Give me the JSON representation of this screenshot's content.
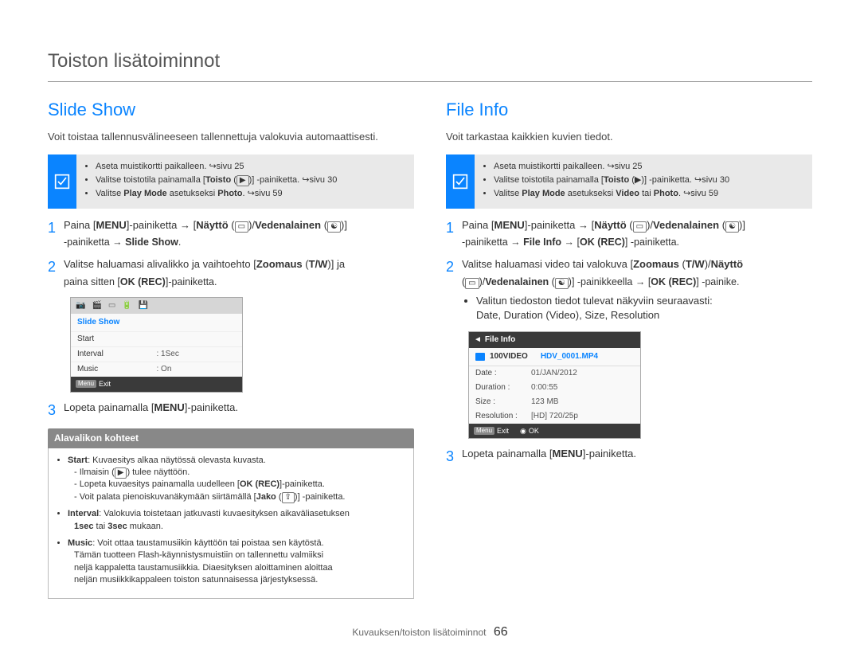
{
  "page_title": "Toiston lisätoiminnot",
  "footer": {
    "section": "Kuvauksen/toiston lisätoiminnot",
    "page_number": "66"
  },
  "left": {
    "title": "Slide Show",
    "intro": "Voit toistaa tallennusvälineeseen tallennettuja valokuvia automaattisesti.",
    "note": {
      "items": [
        {
          "pre": "Aseta muistikortti paikalleen. ",
          "arrow": "↪",
          "suf": "sivu 25"
        },
        {
          "pre": "Valitse toistotila painamalla [",
          "bold": "Toisto",
          " (": " (",
          "icon": "▶",
          ")": ")",
          "post": "] -painiketta. ",
          "arrow2": "↪",
          "suf2": "sivu 30"
        },
        {
          "pre3": "Valitse ",
          "bold3a": "Play Mode",
          "mid3": " asetukseksi ",
          "bold3b": "Photo",
          "post3": ". ",
          "arrow3": "↪",
          "suf3": "sivu 59"
        }
      ]
    },
    "steps": [
      {
        "n": "1",
        "line1a": "Paina [",
        "line1b": "MENU",
        "line1c": "]-painiketta → [",
        "line1d": "Näyttö",
        "line1e": " (",
        "iconDisp": "▭",
        "line1f": ")/",
        "line1g": "Vedenalainen",
        "line1h": " (",
        "iconUw": "☯",
        "line1i": ")]",
        "line2a": "-painiketta → ",
        "line2b": "Slide Show",
        "line2c": "."
      },
      {
        "n": "2",
        "line1a": "Valitse haluamasi alivalikko ja vaihtoehto [",
        "line1b": "Zoomaus",
        "line1c": " (",
        "line1d": "T/W",
        "line1e": ")] ja",
        "line2a": "paina sitten [",
        "line2b": "OK (REC)",
        "line2c": "]-painiketta."
      },
      {
        "n": "3",
        "line1a": "Lopeta painamalla [",
        "line1b": "MENU",
        "line1c": "]-painiketta."
      }
    ],
    "lcd": {
      "title": "Slide Show",
      "rows": [
        {
          "k": "Start",
          "v": ""
        },
        {
          "k": "Interval",
          "v": ": 1Sec"
        },
        {
          "k": "Music",
          "v": ": On"
        }
      ],
      "exit": "Exit"
    },
    "submenu": {
      "header": "Alavalikon kohteet",
      "start": {
        "key": "Start",
        "desc": ": Kuvaesitys alkaa näytössä olevasta kuvasta.",
        "sub1a": "Ilmaisin (",
        "sub1icon": "▶",
        "sub1b": ") tulee näyttöön.",
        "sub2a": "Lopeta kuvaesitys painamalla uudelleen [",
        "sub2b": "OK (REC)",
        "sub2c": "]-painiketta.",
        "sub3a": "Voit palata pienoiskuvanäkymään siirtämällä [",
        "sub3b": "Jako",
        "sub3c": " (",
        "sub3icon": "⇪",
        "sub3d": ")] -painiketta."
      },
      "interval": {
        "key": "Interval",
        "desc": ": Valokuvia toistetaan jatkuvasti kuvaesityksen aikaväliasetuksen",
        "sub1a": "1sec",
        "sub1b": " tai ",
        "sub1c": "3sec",
        "sub1d": " mukaan."
      },
      "music": {
        "key": "Music",
        "desc": ": Voit ottaa taustamusiikin käyttöön tai poistaa sen käytöstä.",
        "p1": "Tämän tuotteen Flash-käynnistysmuistiin on tallennettu valmiiksi",
        "p2": "neljä kappaletta taustamusiikkia. Diaesityksen aloittaminen aloittaa",
        "p3": "neljän musiikkikappaleen toiston satunnaisessa järjestyksessä."
      }
    }
  },
  "right": {
    "title": "File Info",
    "intro": "Voit tarkastaa kaikkien kuvien tiedot.",
    "note": {
      "items": [
        {
          "pre": "Aseta muistikortti paikalleen. ",
          "arrow": "↪",
          "suf": "sivu 25"
        },
        {
          "pre": "Valitse toistotila painamalla [",
          "bold": "Toisto",
          "post": " (▶)] -painiketta. ",
          "arrow2": "↪",
          "suf2": "sivu 30"
        },
        {
          "pre3": "Valitse ",
          "bold3a": "Play Mode",
          "mid3": " asetukseksi ",
          "bold3b": "Video",
          "mid3b": " tai ",
          "bold3c": "Photo",
          "post3": ". ",
          "arrow3": "↪",
          "suf3": "sivu 59"
        }
      ]
    },
    "steps": [
      {
        "n": "1",
        "l1a": "Paina [",
        "l1b": "MENU",
        "l1c": "]-painiketta → [",
        "l1d": "Näyttö",
        "l1e": " (",
        "iconDisp": "▭",
        "l1f": ")/",
        "l1g": "Vedenalainen",
        "l1h": " (",
        "iconUw": "☯",
        "l1i": ")]",
        "l2a": "-painiketta → ",
        "l2b": "File Info",
        "l2c": " → [",
        "l2d": "OK (REC)",
        "l2e": "] -painiketta."
      },
      {
        "n": "2",
        "l1a": "Valitse haluamasi video tai valokuva [",
        "l1b": "Zoomaus",
        "l1c": " (",
        "l1d": "T/W",
        "l1e": ")/",
        "l1f": "Näyttö",
        "l2a": "(",
        "iconDisp": "▭",
        "l2b": ")/",
        "l2c": "Vedenalainen",
        "l2d": " (",
        "iconUw": "☯",
        "l2e": ")] -painikkeella → [",
        "l2f": "OK (REC)",
        "l2g": "] -painike.",
        "bul1": "Valitun tiedoston tiedot tulevat näkyviin seuraavasti:",
        "bul2": "Date, Duration (Video), Size, Resolution"
      },
      {
        "n": "3",
        "l1a": "Lopeta painamalla [",
        "l1b": "MENU",
        "l1c": "]-painiketta."
      }
    ],
    "lcd": {
      "title": "File Info",
      "folder": "100VIDEO",
      "file": "HDV_0001.MP4",
      "rows": [
        {
          "k": "Date :",
          "v": "01/JAN/2012"
        },
        {
          "k": "Duration :",
          "v": "0:00:55"
        },
        {
          "k": "Size :",
          "v": "123 MB"
        },
        {
          "k": "Resolution :",
          "v": "[HD] 720/25p"
        }
      ],
      "exit": "Exit",
      "ok": "OK"
    }
  }
}
